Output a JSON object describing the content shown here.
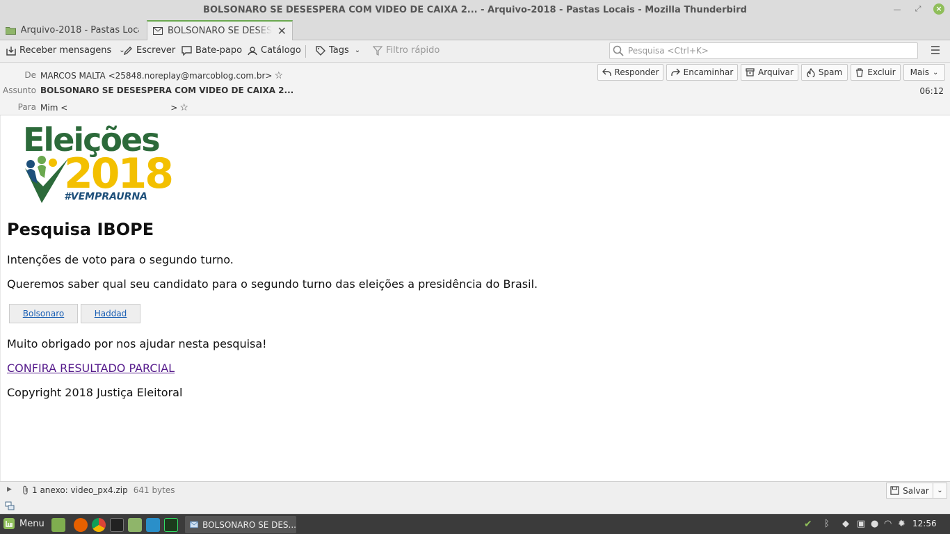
{
  "window": {
    "title": "BOLSONARO SE DESESPERA COM VIDEO DE CAIXA 2... - Arquivo-2018 - Pastas Locais - Mozilla Thunderbird",
    "controls": [
      "minimize-icon",
      "restore-icon",
      "close-icon"
    ]
  },
  "tabs": [
    {
      "label": "Arquivo-2018 - Pastas Locais",
      "icon": "folder-icon"
    },
    {
      "label": "BOLSONARO SE DESESPERA",
      "icon": "envelope-icon"
    }
  ],
  "toolbar": {
    "get_messages": "Receber mensagens",
    "write": "Escrever",
    "chat": "Bate-papo",
    "address_book": "Catálogo",
    "tags": "Tags",
    "quick_filter": "Filtro rápido",
    "search_placeholder": "Pesquisa <Ctrl+K>"
  },
  "header": {
    "from_label": "De",
    "from_value": "MARCOS MALTA <25848.noreplay@marcoblog.com.br>",
    "subject_label": "Assunto",
    "subject_value": "BOLSONARO SE DESESPERA COM VIDEO DE CAIXA 2...",
    "to_label": "Para",
    "to_prefix": "Mim <",
    "to_suffix": ">",
    "time": "06:12",
    "actions": {
      "reply": "Responder",
      "forward": "Encaminhar",
      "archive": "Arquivar",
      "spam": "Spam",
      "delete": "Excluir",
      "more": "Mais"
    }
  },
  "message": {
    "logo": {
      "title": "Eleições",
      "year": "2018",
      "hashtag": "#VEMPRAURNA"
    },
    "heading": "Pesquisa IBOPE",
    "line1": "Intenções de voto para o segundo turno.",
    "line2": "Queremos saber qual seu candidato para o segundo turno das eleições a presidência do Brasil.",
    "options": [
      "Bolsonaro",
      "Haddad"
    ],
    "thanks": "Muito obrigado por nos ajudar nesta pesquisa!",
    "link": "CONFIRA RESULTADO PARCIAL",
    "copyright": "Copyright 2018 Justiça Eleitoral"
  },
  "attachment": {
    "summary": "1 anexo: video_px4.zip",
    "size": "641 bytes",
    "save": "Salvar"
  },
  "taskbar": {
    "menu": "Menu",
    "window": "BOLSONARO SE DES...",
    "clock": "12:56"
  },
  "colors": {
    "accent_tab": "#6aa84f",
    "link_visited": "#551a8b",
    "link": "#1a5fb4",
    "logo_green": "#2c6a3a",
    "logo_yellow": "#f3c000",
    "logo_blue": "#1d4f7a"
  }
}
